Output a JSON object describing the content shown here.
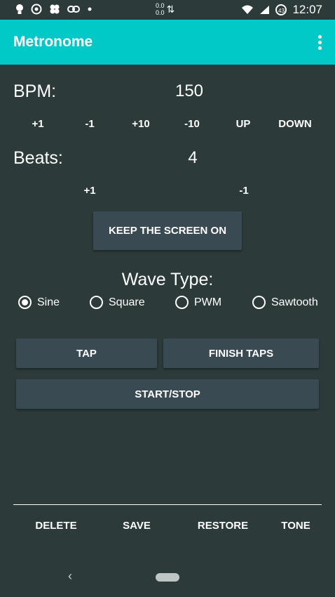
{
  "status_bar": {
    "left_icons": [
      "lightbulb-icon",
      "whatsapp-icon",
      "pinwheel-icon",
      "link-icon",
      "dot-icon"
    ],
    "net_speed_top": "0.0",
    "net_speed_bottom": "0.0",
    "time": "12:07",
    "battery_level": "43"
  },
  "app_bar": {
    "title": "Metronome"
  },
  "bpm": {
    "label": "BPM:",
    "value": "150",
    "buttons": [
      "+1",
      "-1",
      "+10",
      "-10",
      "UP",
      "DOWN"
    ]
  },
  "beats": {
    "label": "Beats:",
    "value": "4",
    "buttons": [
      "+1",
      "-1"
    ]
  },
  "keep_screen_on_label": "KEEP THE SCREEN ON",
  "wave": {
    "title": "Wave Type:",
    "options": [
      "Sine",
      "Square",
      "PWM",
      "Sawtooth"
    ],
    "selected": "Sine"
  },
  "tap_label": "TAP",
  "finish_taps_label": "FINISH TAPS",
  "start_stop_label": "START/STOP",
  "bottom_bar": [
    "DELETE",
    "SAVE",
    "RESTORE",
    "TONE"
  ]
}
